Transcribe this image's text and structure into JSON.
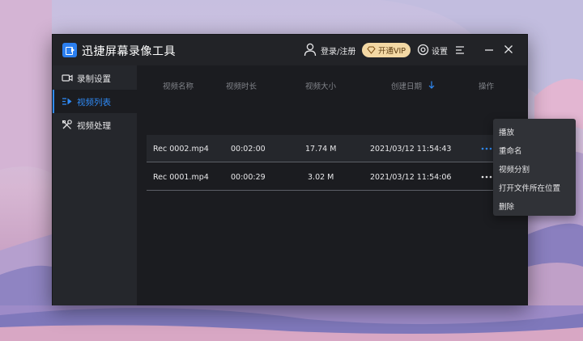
{
  "app": {
    "title": "迅捷屏幕录像工具",
    "login_label": "登录/注册",
    "vip_label": "开通VIP",
    "settings_label": "设置"
  },
  "sidebar": {
    "items": [
      {
        "label": "录制设置",
        "icon": "video-camera-icon",
        "active": false
      },
      {
        "label": "视频列表",
        "icon": "video-list-icon",
        "active": true
      },
      {
        "label": "视频处理",
        "icon": "tools-icon",
        "active": false
      }
    ]
  },
  "table": {
    "headers": [
      "视频名称",
      "视频时长",
      "视频大小",
      "创建日期",
      "操作"
    ],
    "sort_column": "创建日期",
    "rows": [
      {
        "name": "Rec 0002.mp4",
        "duration": "00:02:00",
        "size": "17.74 M",
        "date": "2021/03/12 11:54:43",
        "hover": true
      },
      {
        "name": "Rec 0001.mp4",
        "duration": "00:00:29",
        "size": "3.02 M",
        "date": "2021/03/12 11:54:06",
        "hover": false
      }
    ]
  },
  "context_menu": {
    "items": [
      "播放",
      "重命名",
      "视频分割",
      "打开文件所在位置",
      "删除"
    ]
  },
  "colors": {
    "accent": "#2f8af5",
    "vip_bg": "#f3d8a4",
    "window_bg": "#25272c",
    "panel_bg": "#1b1c20"
  }
}
